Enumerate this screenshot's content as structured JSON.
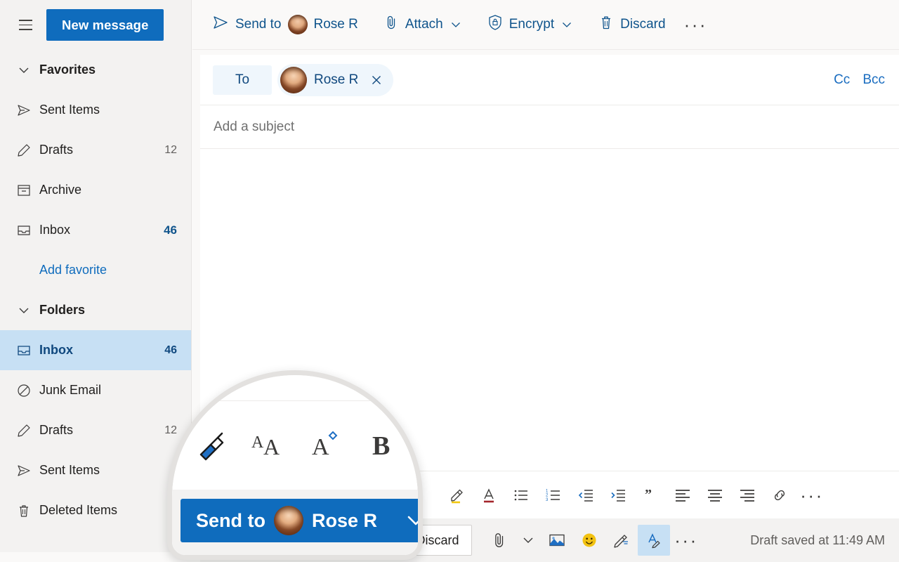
{
  "app": {
    "accent_blue": "#0f6cbd",
    "selected_row_bg": "#c7e0f4",
    "sidebar_bg": "#f3f2f1"
  },
  "sidebar": {
    "hamburger_name": "hamburger-menu-icon",
    "new_message_label": "New message",
    "favorites": {
      "title": "Favorites",
      "items": [
        {
          "label": "Sent Items",
          "count": "",
          "icon": "send-icon"
        },
        {
          "label": "Drafts",
          "count": "12",
          "icon": "pencil-icon"
        },
        {
          "label": "Archive",
          "count": "",
          "icon": "archive-icon"
        },
        {
          "label": "Inbox",
          "count": "46",
          "icon": "inbox-icon"
        }
      ],
      "add_favorite_label": "Add favorite"
    },
    "folders": {
      "title": "Folders",
      "items": [
        {
          "label": "Inbox",
          "count": "46",
          "icon": "inbox-icon",
          "selected": true
        },
        {
          "label": "Junk Email",
          "count": "",
          "icon": "block-icon",
          "selected": false
        },
        {
          "label": "Drafts",
          "count": "12",
          "icon": "pencil-icon",
          "selected": false
        },
        {
          "label": "Sent Items",
          "count": "",
          "icon": "send-icon",
          "selected": false
        },
        {
          "label": "Deleted Items",
          "count": "",
          "icon": "trash-icon",
          "selected": false
        }
      ]
    }
  },
  "toolbar": {
    "send_to_label": "Send to",
    "send_to_recipient": "Rose R",
    "attach_label": "Attach",
    "encrypt_label": "Encrypt",
    "discard_label": "Discard",
    "overflow_label": "···"
  },
  "compose": {
    "to_label": "To",
    "recipient_name": "Rose R",
    "remove_recipient_name": "remove-recipient-icon",
    "cc_label": "Cc",
    "bcc_label": "Bcc",
    "subject_placeholder": "Add a subject",
    "body_value": ""
  },
  "format_toolbar": {
    "items": [
      {
        "name": "highlight-icon"
      },
      {
        "name": "font-color-icon"
      },
      {
        "name": "bulleted-list-icon"
      },
      {
        "name": "numbered-list-icon"
      },
      {
        "name": "decrease-indent-icon"
      },
      {
        "name": "increase-indent-icon"
      },
      {
        "name": "quote-icon"
      },
      {
        "name": "align-left-icon"
      },
      {
        "name": "align-center-icon"
      },
      {
        "name": "align-right-icon"
      },
      {
        "name": "link-icon"
      }
    ],
    "overflow_label": "···"
  },
  "bottom_bar": {
    "discard_label": "Discard",
    "attach_icon": "attachment-icon",
    "attach_chevron": "chevron-down-icon",
    "image_icon": "insert-picture-icon",
    "emoji_icon": "emoji-icon",
    "signature_icon": "signature-pen-icon",
    "editor_icon": "editor-proofing-icon",
    "overflow_label": "···",
    "draft_status": "Draft saved at 11:49 AM"
  },
  "callout": {
    "format_icons": [
      {
        "name": "format-painter-icon"
      },
      {
        "name": "font-size-icon"
      },
      {
        "name": "font-color-picker-icon"
      },
      {
        "name": "bold-icon"
      }
    ],
    "send_label": "Send to",
    "send_recipient": "Rose R",
    "chevron_name": "send-options-chevron-icon",
    "ghost_discard_label": "card"
  }
}
